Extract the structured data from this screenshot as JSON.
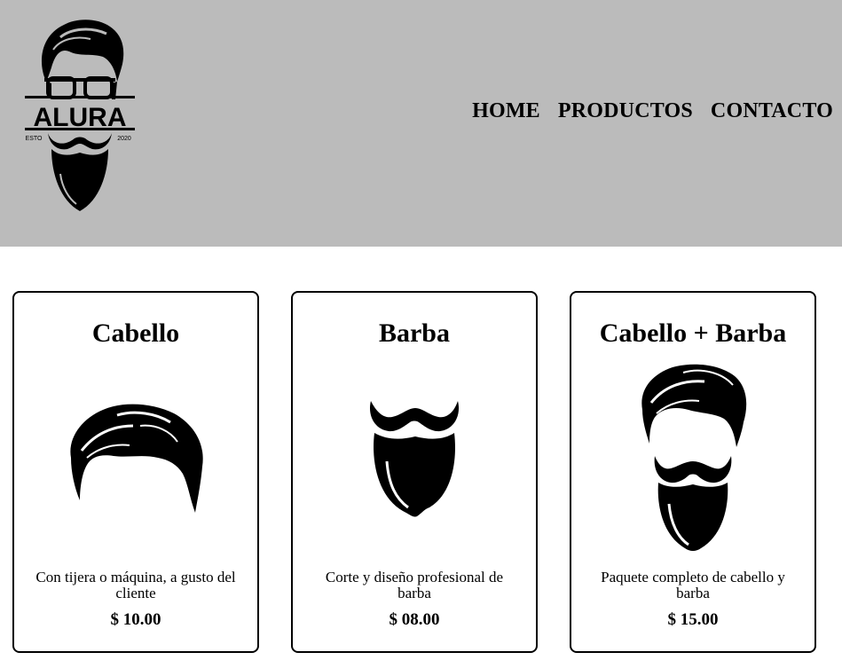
{
  "header": {
    "logo": {
      "brand": "ALURA",
      "left_text": "ESTO",
      "right_text": "2020",
      "icon": "bearded-man-logo-icon"
    },
    "nav": [
      {
        "label": "HOME"
      },
      {
        "label": "PRODUCTOS"
      },
      {
        "label": "CONTACTO"
      }
    ],
    "background_color": "#bbbbbb"
  },
  "products": [
    {
      "title": "Cabello",
      "description": "Con tijera o máquina, a gusto del cliente",
      "price": "$ 10.00",
      "icon": "hair-icon"
    },
    {
      "title": "Barba",
      "description": "Corte y diseño profesional de barba",
      "price": "$ 08.00",
      "icon": "beard-icon"
    },
    {
      "title": "Cabello + Barba",
      "description": "Paquete completo de cabello y barba",
      "price": "$ 15.00",
      "icon": "hair-and-beard-icon"
    }
  ]
}
